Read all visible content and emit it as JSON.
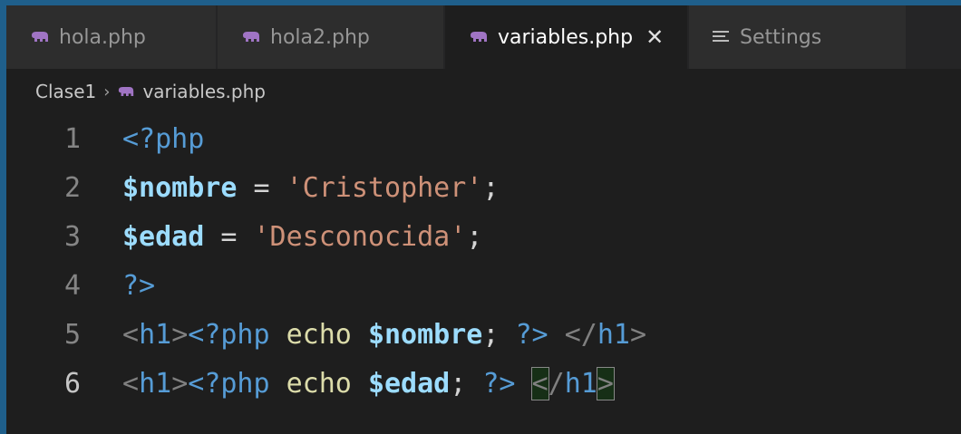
{
  "tabs": [
    {
      "label": "hola.php",
      "active": false
    },
    {
      "label": "hola2.php",
      "active": false
    },
    {
      "label": "variables.php",
      "active": true,
      "close": "✕"
    },
    {
      "label": "Settings",
      "active": false
    }
  ],
  "breadcrumb": {
    "folder": "Clase1",
    "separator": "›",
    "file": "variables.php"
  },
  "editor": {
    "current_line": 6,
    "lines": [
      {
        "n": "1",
        "tokens": [
          {
            "t": "<?php",
            "c": "tag"
          }
        ]
      },
      {
        "n": "2",
        "tokens": [
          {
            "t": "$nombre",
            "c": "var"
          },
          {
            "t": " = ",
            "c": "plain"
          },
          {
            "t": "'Cristopher'",
            "c": "str"
          },
          {
            "t": ";",
            "c": "plain"
          }
        ]
      },
      {
        "n": "3",
        "tokens": [
          {
            "t": "$edad",
            "c": "var"
          },
          {
            "t": " = ",
            "c": "plain"
          },
          {
            "t": "'Desconocida'",
            "c": "str"
          },
          {
            "t": ";",
            "c": "plain"
          }
        ]
      },
      {
        "n": "4",
        "tokens": [
          {
            "t": "?>",
            "c": "tag"
          }
        ]
      },
      {
        "n": "5",
        "tokens": [
          {
            "t": "<",
            "c": "punc"
          },
          {
            "t": "h1",
            "c": "tag"
          },
          {
            "t": ">",
            "c": "punc"
          },
          {
            "t": "<?php",
            "c": "tag"
          },
          {
            "t": " ",
            "c": "plain"
          },
          {
            "t": "echo",
            "c": "fn"
          },
          {
            "t": " ",
            "c": "plain"
          },
          {
            "t": "$nombre",
            "c": "var"
          },
          {
            "t": "; ",
            "c": "plain"
          },
          {
            "t": "?>",
            "c": "tag"
          },
          {
            "t": " ",
            "c": "plain"
          },
          {
            "t": "</",
            "c": "punc"
          },
          {
            "t": "h1",
            "c": "tag"
          },
          {
            "t": ">",
            "c": "punc"
          }
        ]
      },
      {
        "n": "6",
        "tokens": [
          {
            "t": "<",
            "c": "punc"
          },
          {
            "t": "h1",
            "c": "tag"
          },
          {
            "t": ">",
            "c": "punc"
          },
          {
            "t": "<?php",
            "c": "tag"
          },
          {
            "t": " ",
            "c": "plain"
          },
          {
            "t": "echo",
            "c": "fn"
          },
          {
            "t": " ",
            "c": "plain"
          },
          {
            "t": "$edad",
            "c": "var"
          },
          {
            "t": "; ",
            "c": "plain"
          },
          {
            "t": "?>",
            "c": "tag"
          },
          {
            "t": " ",
            "c": "plain"
          },
          {
            "t": "<",
            "c": "punc",
            "match": true
          },
          {
            "t": "/",
            "c": "punc"
          },
          {
            "t": "h1",
            "c": "tag"
          },
          {
            "t": ">",
            "c": "punc",
            "match": true
          }
        ]
      }
    ]
  },
  "colors": {
    "php_icon": "#a074c4",
    "frame_border": "#1f5f8b",
    "editor_bg": "#1e1e1e"
  },
  "icons": {
    "php_file": "php-elephant-icon",
    "settings": "settings-list-icon"
  }
}
